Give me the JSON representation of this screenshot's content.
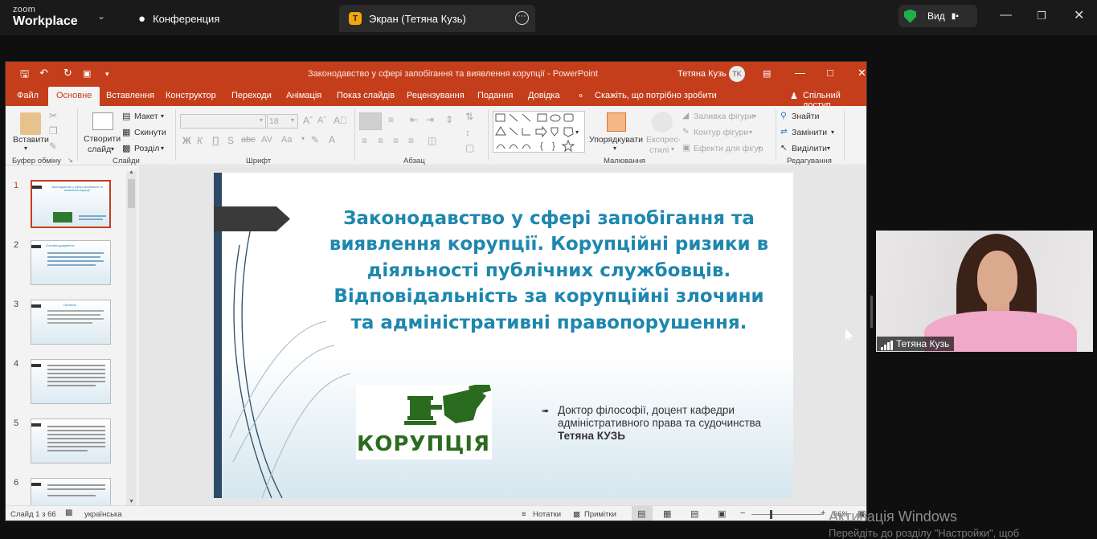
{
  "zoom": {
    "logo_top": "zoom",
    "logo_bottom": "Workplace",
    "tab_conference": "Конференция",
    "tab_screen_badge": "T",
    "tab_screen": "Экран (Тетяна Кузь)",
    "view_label": "Вид"
  },
  "ppt": {
    "title": "Законодавство у сфері запобігання та виявлення корупції  -  PowerPoint",
    "user": "Тетяна Кузь",
    "user_initials": "TK",
    "menu": [
      "Файл",
      "Основне",
      "Вставлення",
      "Конструктор",
      "Переходи",
      "Анімація",
      "Показ слайдів",
      "Рецензування",
      "Подання",
      "Довідка"
    ],
    "tell_me": "Скажіть, що потрібно зробити",
    "share": "Спільний доступ",
    "ribbon": {
      "paste": "Вставити",
      "clipboard_group": "Буфер обміну",
      "new_slide": "Створити",
      "new_slide2": "слайд",
      "layout": "Макет",
      "reset": "Скинути",
      "section": "Розділ",
      "slides_group": "Слайди",
      "font_size": "18",
      "font_group": "Шрифт",
      "paragraph_group": "Абзац",
      "arrange": "Упорядкувати",
      "quick_styles1": "Експрес-",
      "quick_styles2": "стилі",
      "shape_fill": "Заливка фігури",
      "shape_outline": "Контур фігури",
      "shape_effects": "Ефекти для фігур",
      "drawing_group": "Малювання",
      "find": "Знайти",
      "replace": "Замінити",
      "select": "Виділити",
      "editing_group": "Редагування"
    },
    "thumbs": [
      "1",
      "2",
      "3",
      "4",
      "5",
      "6"
    ],
    "thumb1_lines": "Законодавство у сфері запобігання та виявлення корупції",
    "thumb2_lines": "Основні документи",
    "thumb3_lines": "Питання",
    "slide": {
      "title": "Законодавство у сфері запобігання та виявлення корупції. Корупційні ризики в діяльності публічних службовців. Відповідальність за корупційні злочини та адміністративні правопорушення.",
      "logo_text": "КОРУПЦІЯ",
      "bullet_prefix": "Доктор філософії, доцент кафедри адміністративного права та судочинства ",
      "bullet_name": "Тетяна КУЗЬ"
    },
    "status": {
      "slide_no": "Слайд 1 з 66",
      "language": "українська",
      "notes": "Нотатки",
      "comments": "Примітки",
      "zoom": "66%"
    }
  },
  "camera": {
    "name": "Тетяна Кузь"
  },
  "watermark": {
    "line1": "Активація Windows",
    "line2": "Перейдіть до розділу \"Настройки\", щоб"
  }
}
